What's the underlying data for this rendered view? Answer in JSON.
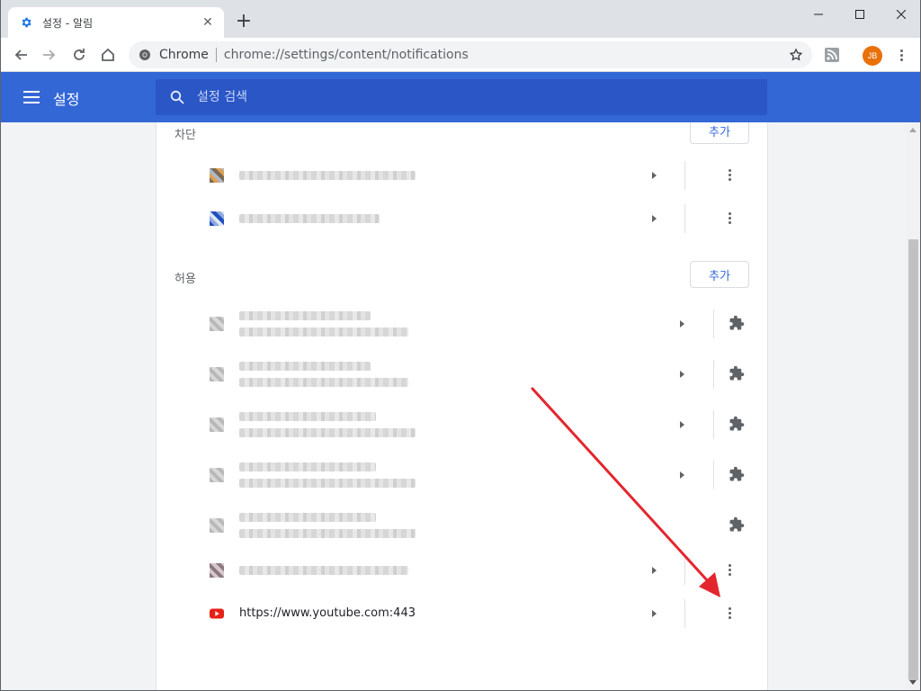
{
  "browser": {
    "tab": {
      "title": "설정 - 알림",
      "favicon": "gear-icon"
    },
    "omnibox": {
      "origin": "Chrome",
      "url": "chrome://settings/content/notifications"
    },
    "avatar_initials": "JB"
  },
  "settings_header": {
    "title": "설정",
    "search_placeholder": "설정 검색"
  },
  "blocked": {
    "label": "차단",
    "add_label": "추가"
  },
  "allowed": {
    "label": "허용",
    "add_label": "추가"
  },
  "sites": {
    "youtube": {
      "url": "https://www.youtube.com:443"
    }
  },
  "colors": {
    "header": "#3367d6",
    "search": "#2a56c6",
    "accent": "#3367d6",
    "annotation_arrow": "#e3262e"
  }
}
